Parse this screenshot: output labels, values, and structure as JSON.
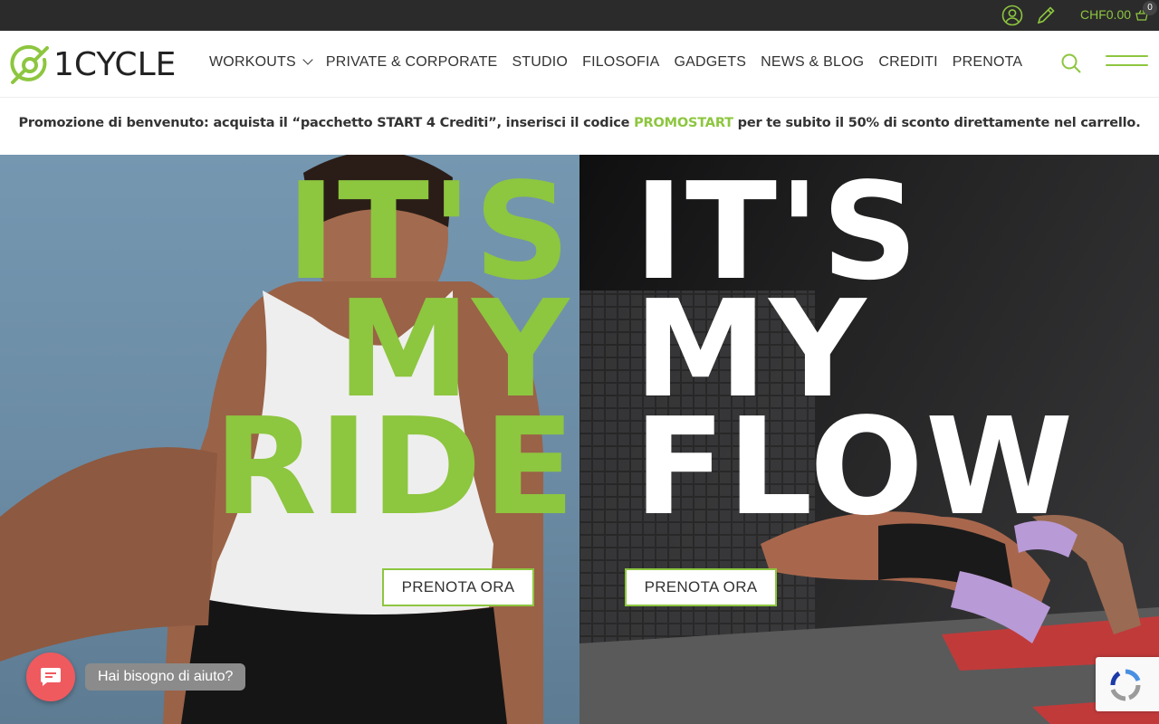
{
  "topbar": {
    "cart_amount": "CHF0.00",
    "cart_count": "0",
    "icons": [
      "user-icon",
      "pencil-icon",
      "basket-icon"
    ]
  },
  "header": {
    "logo_text": "1CYCLE",
    "nav": [
      {
        "label": "WORKOUTS",
        "has_dropdown": true
      },
      {
        "label": "PRIVATE & CORPORATE"
      },
      {
        "label": "STUDIO"
      },
      {
        "label": "FILOSOFIA"
      },
      {
        "label": "GADGETS"
      },
      {
        "label": "NEWS & BLOG"
      },
      {
        "label": "CREDITI"
      },
      {
        "label": "PRENOTA"
      }
    ]
  },
  "promo": {
    "before": "Promozione di benvenuto: acquista il “pacchetto START 4 Crediti”, inserisci il codice ",
    "code": "PROMOSTART",
    "after": " per te subito il 50% di sconto direttamente nel carrello."
  },
  "hero_left": {
    "line1": "IT'S",
    "line2": "MY",
    "line3": "RIDE",
    "cta": "PRENOTA ORA"
  },
  "hero_right": {
    "line1": "IT'S",
    "line2": "MY",
    "line3": "FLOW",
    "cta": "PRENOTA ORA"
  },
  "chat": {
    "label": "Hai bisogno di aiuto?"
  },
  "colors": {
    "accent": "#8dc63f",
    "topbar": "#2b2b2b",
    "chat": "#ef5a5f"
  }
}
